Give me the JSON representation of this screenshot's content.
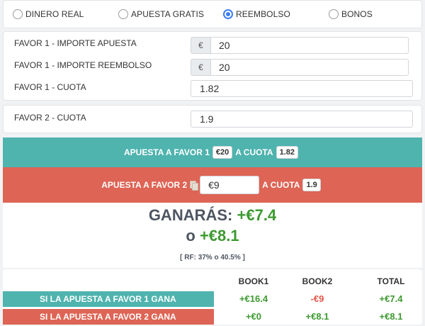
{
  "modes": [
    {
      "label": "DINERO REAL",
      "selected": false
    },
    {
      "label": "APUESTA GRATIS",
      "selected": false
    },
    {
      "label": "REEMBOLSO",
      "selected": true
    },
    {
      "label": "BONOS",
      "selected": false
    }
  ],
  "form": {
    "stake_label": "FAVOR 1 - IMPORTE APUESTA",
    "stake_currency": "€",
    "stake_value": "20",
    "refund_label": "FAVOR 1 - IMPORTE REEMBOLSO",
    "refund_currency": "€",
    "refund_value": "20",
    "odds1_label": "FAVOR 1 - CUOTA",
    "odds1_value": "1.82",
    "odds2_label": "FAVOR 2 - CUOTA",
    "odds2_value": "1.9"
  },
  "bet1": {
    "prefix": "APUESTA A FAVOR 1",
    "amount": "€20",
    "odds_label": "A CUOTA",
    "odds": "1.82",
    "color": "#4fb3ae"
  },
  "bet2": {
    "prefix": "APUESTA A FAVOR 2",
    "amount": "€9",
    "odds_label": "A CUOTA",
    "odds": "1.9",
    "color": "#de6455"
  },
  "result": {
    "win_label": "GANARÁS:",
    "win_value": "+€7.4",
    "or_label": "o",
    "alt_value": "+€8.1",
    "rf_text": "[ RF: 37% o 40.5% ]"
  },
  "summary_table": {
    "headers": [
      "BOOK1",
      "BOOK2",
      "TOTAL"
    ],
    "rows": [
      {
        "label": "SI LA APUESTA A FAVOR 1 GANA",
        "book1": "+€16.4",
        "book2": "-€9",
        "total": "+€7.4"
      },
      {
        "label": "SI LA APUESTA A FAVOR 2 GANA",
        "book1": "+€0",
        "book2": "+€8.1",
        "total": "+€8.1"
      }
    ]
  },
  "icons": {
    "copy": "copy-icon"
  }
}
